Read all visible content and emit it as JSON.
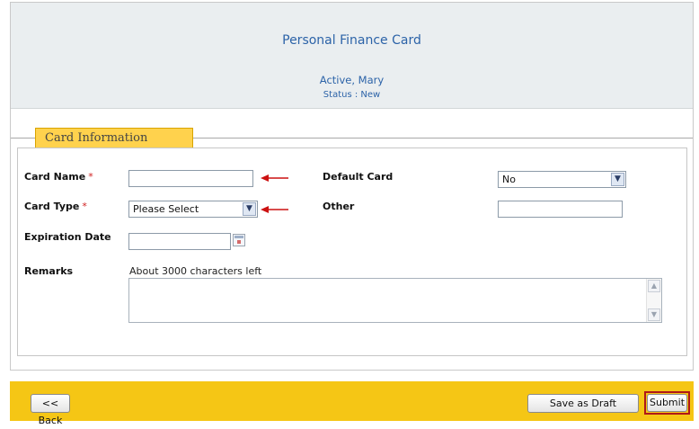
{
  "header": {
    "title": "Personal Finance Card",
    "name": "Active, Mary",
    "status": "Status : New"
  },
  "section": {
    "legend": "Card Information"
  },
  "form": {
    "card_name_label": "Card Name",
    "card_name_value": "",
    "card_type_label": "Card Type",
    "card_type_value": "Please Select",
    "expiration_label": "Expiration Date",
    "expiration_value": "",
    "remarks_label": "Remarks",
    "remarks_hint": "About 3000 characters left",
    "remarks_value": "",
    "default_card_label": "Default Card",
    "default_card_value": "No",
    "other_label": "Other",
    "other_value": "",
    "required_mark": "*"
  },
  "footer": {
    "back_label": "<< Back",
    "save_draft_label": "Save as Draft",
    "submit_label": "Submit"
  },
  "colors": {
    "header_bg": "#eaeef0",
    "title_blue": "#2c63a8",
    "legend_yellow": "#ffd24d",
    "footer_yellow": "#f5c615",
    "required_red": "#d02020",
    "annotation_red": "#cc1111"
  },
  "icons": {
    "calendar": "calendar-icon",
    "dropdown": "chevron-down-icon",
    "annotation_arrow": "red-arrow-left-icon"
  }
}
